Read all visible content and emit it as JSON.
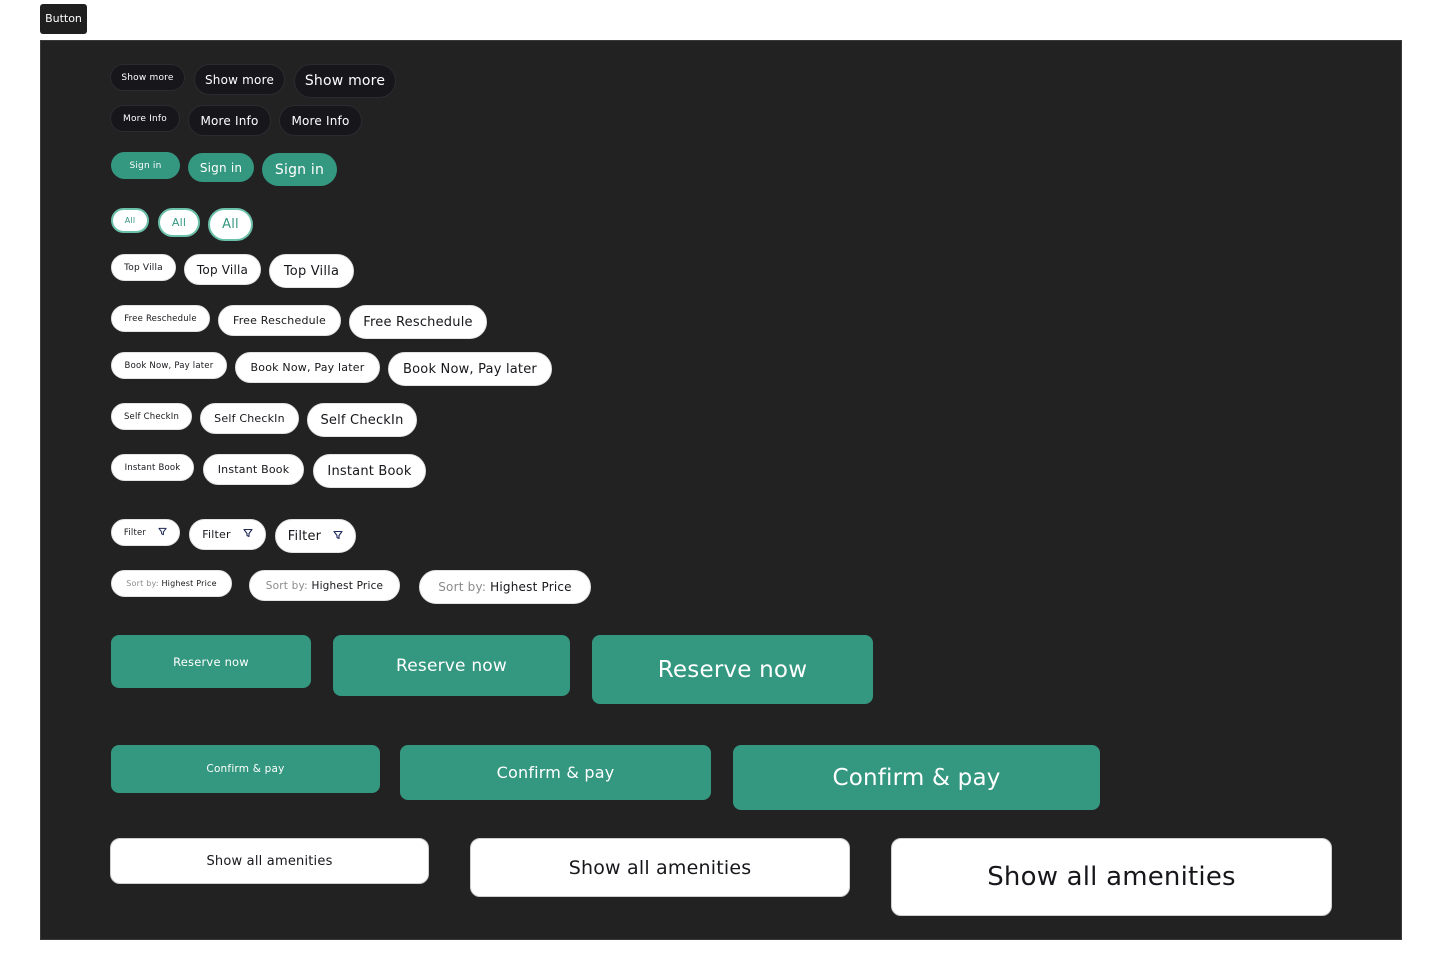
{
  "frame_label": "Button",
  "colors": {
    "canvas": "#222222",
    "dark_button": "#17161b",
    "accent_green": "#349780",
    "outline_green": "#6ac0a9",
    "white": "#ffffff",
    "muted_text": "#8b8b8b"
  },
  "rows": {
    "show_more": [
      "Show more",
      "Show more",
      "Show more"
    ],
    "more_info": [
      "More Info",
      "More Info",
      "More Info"
    ],
    "sign_in": [
      "Sign in",
      "Sign in",
      "Sign in"
    ],
    "all": [
      "All",
      "All",
      "All"
    ],
    "top_villa": [
      "Top Villa",
      "Top Villa",
      "Top Villa"
    ],
    "free_reschedule": [
      "Free Reschedule",
      "Free Reschedule",
      "Free Reschedule"
    ],
    "book_now_pay_later": [
      "Book Now, Pay later",
      "Book Now, Pay later",
      "Book Now, Pay later"
    ],
    "self_checkin": [
      "Self CheckIn",
      "Self CheckIn",
      "Self CheckIn"
    ],
    "instant_book": [
      "Instant Book",
      "Instant Book",
      "Instant Book"
    ],
    "filter": [
      "Filter",
      "Filter",
      "Filter"
    ],
    "filter_icon": "filter-funnel-icon",
    "sort_by": {
      "prefix": "Sort by:",
      "values": [
        "Highest Price",
        "Highest Price",
        "Highest Price"
      ]
    },
    "reserve_now": [
      "Reserve now",
      "Reserve now",
      "Reserve now"
    ],
    "confirm_pay": [
      "Confirm & pay",
      "Confirm & pay",
      "Confirm & pay"
    ],
    "show_all_amenities": [
      "Show all amenities",
      "Show all amenities",
      "Show all amenities"
    ]
  }
}
